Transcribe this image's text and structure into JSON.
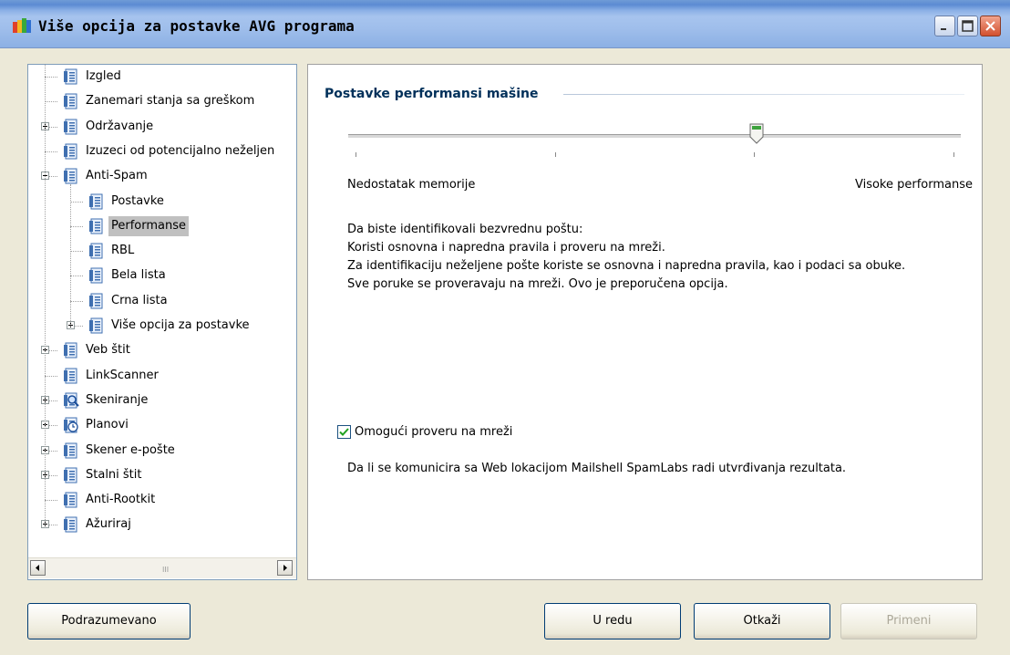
{
  "window": {
    "title": "Više opcija za postavke AVG programa",
    "icon": "avg-logo-icon"
  },
  "tree": {
    "items": [
      {
        "label": "Izgled",
        "level": 0,
        "expander": "none",
        "icon": "settings-page-icon"
      },
      {
        "label": "Zanemari stanja sa greškom",
        "level": 0,
        "expander": "none",
        "icon": "settings-page-icon"
      },
      {
        "label": "Održavanje",
        "level": 0,
        "expander": "plus",
        "icon": "settings-page-icon"
      },
      {
        "label": "Izuzeci od potencijalno neželjen",
        "level": 0,
        "expander": "none",
        "icon": "settings-page-icon"
      },
      {
        "label": "Anti-Spam",
        "level": 0,
        "expander": "minus",
        "icon": "settings-page-icon"
      },
      {
        "label": "Postavke",
        "level": 1,
        "expander": "none",
        "icon": "settings-page-icon"
      },
      {
        "label": "Performanse",
        "level": 1,
        "expander": "none",
        "icon": "settings-page-icon",
        "selected": true
      },
      {
        "label": "RBL",
        "level": 1,
        "expander": "none",
        "icon": "settings-page-icon"
      },
      {
        "label": "Bela lista",
        "level": 1,
        "expander": "none",
        "icon": "settings-page-icon"
      },
      {
        "label": "Crna lista",
        "level": 1,
        "expander": "none",
        "icon": "settings-page-icon"
      },
      {
        "label": "Više opcija za postavke",
        "level": 1,
        "expander": "plus",
        "icon": "settings-page-icon"
      },
      {
        "label": "Veb štit",
        "level": 0,
        "expander": "plus",
        "icon": "settings-page-icon"
      },
      {
        "label": "LinkScanner",
        "level": 0,
        "expander": "none",
        "icon": "settings-page-icon"
      },
      {
        "label": "Skeniranje",
        "level": 0,
        "expander": "plus",
        "icon": "scan-magnifier-icon"
      },
      {
        "label": "Planovi",
        "level": 0,
        "expander": "plus",
        "icon": "schedule-clock-icon"
      },
      {
        "label": "Skener e-pošte",
        "level": 0,
        "expander": "plus",
        "icon": "settings-page-icon"
      },
      {
        "label": "Stalni štit",
        "level": 0,
        "expander": "plus",
        "icon": "settings-page-icon"
      },
      {
        "label": "Anti-Rootkit",
        "level": 0,
        "expander": "none",
        "icon": "settings-page-icon"
      },
      {
        "label": "Ažuriraj",
        "level": 0,
        "expander": "plus",
        "icon": "settings-page-icon"
      }
    ],
    "scrollbar_grip": "III"
  },
  "panel": {
    "section_title": "Postavke performansi mašine",
    "slider": {
      "position_fraction": 0.67,
      "tick_count": 4,
      "min_label": "Nedostatak memorije",
      "max_label": "Visoke performanse"
    },
    "description_lines": [
      "Da biste identifikovali bezvrednu poštu:",
      "Koristi osnovna i napredna pravila i proveru na mreži.",
      "Za identifikaciju neželjene pošte koriste se osnovna i napredna pravila, kao i podaci sa obuke.",
      "Sve poruke se proveravaju na mreži. Ovo je preporučena opcija."
    ],
    "online_check": {
      "label": "Omogući proveru na mreži",
      "checked": true
    },
    "note": "Da li se komunicira sa Web lokacijom Mailshell SpamLabs radi utvrđivanja rezultata."
  },
  "buttons": {
    "default": "Podrazumevano",
    "ok": "U redu",
    "cancel": "Otkaži",
    "apply": "Primeni",
    "apply_enabled": false
  },
  "colors": {
    "section_title": "#00305a",
    "selection": "#c0c0c0",
    "check_mark": "#21a121"
  }
}
